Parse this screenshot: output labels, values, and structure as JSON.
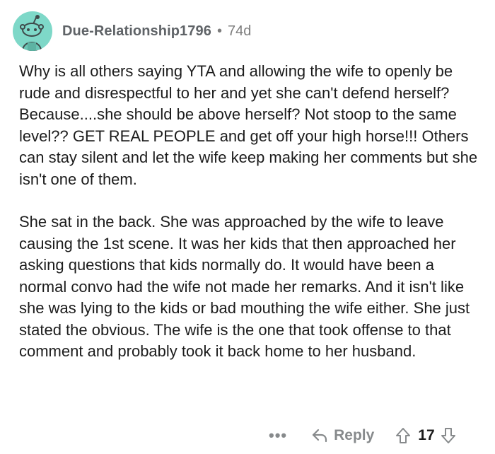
{
  "comment": {
    "author": "Due-Relationship1796",
    "separator": "•",
    "age": "74d",
    "paragraphs": [
      "Why is all others saying YTA and allowing the wife to openly be rude and disrespectful to her and yet she can't defend herself? Because....she should be above herself? Not stoop to the same level?? GET REAL PEOPLE and get off your high horse!!! Others can stay silent and let the wife keep making her comments but she isn't one of them.",
      "She sat in the back. She was approached by the wife to leave causing the 1st scene. It was her kids that then approached her asking questions that kids normally do. It would have been a normal convo had the wife not made her remarks. And it isn't like she was lying to the kids or bad mouthing the wife either. She just stated the obvious. The wife is the one that took offense to that comment and probably took it back home to her husband."
    ]
  },
  "actions": {
    "more_label": "•••",
    "reply_label": "Reply",
    "score": "17"
  },
  "icons": {
    "avatar": "snoo-avatar-icon",
    "reply": "reply-arrow-icon",
    "upvote": "upvote-arrow-icon",
    "downvote": "downvote-arrow-icon"
  },
  "colors": {
    "avatar_bg": "#7ed8c8",
    "meta_text": "#7c7c7c",
    "action_text": "#878a8c",
    "body_text": "#1c1c1c"
  }
}
